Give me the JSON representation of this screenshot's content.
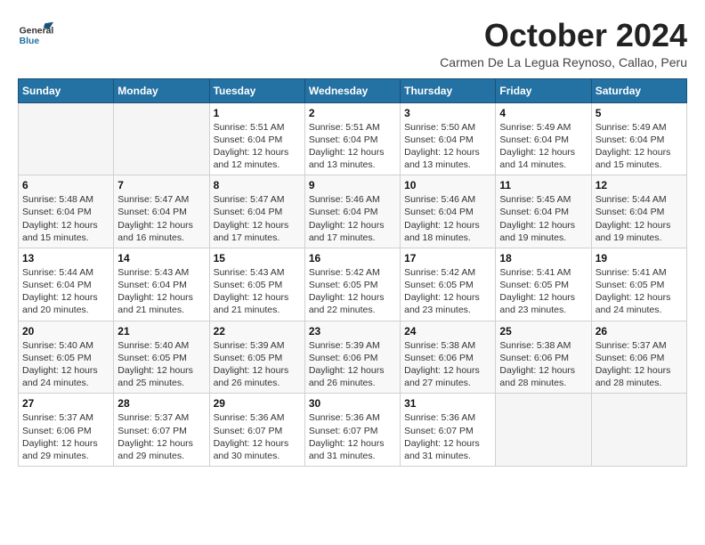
{
  "header": {
    "logo": {
      "line1": "General",
      "line2": "Blue"
    },
    "month": "October 2024",
    "location": "Carmen De La Legua Reynoso, Callao, Peru"
  },
  "weekdays": [
    "Sunday",
    "Monday",
    "Tuesday",
    "Wednesday",
    "Thursday",
    "Friday",
    "Saturday"
  ],
  "weeks": [
    [
      {
        "day": "",
        "info": ""
      },
      {
        "day": "",
        "info": ""
      },
      {
        "day": "1",
        "info": "Sunrise: 5:51 AM\nSunset: 6:04 PM\nDaylight: 12 hours\nand 12 minutes."
      },
      {
        "day": "2",
        "info": "Sunrise: 5:51 AM\nSunset: 6:04 PM\nDaylight: 12 hours\nand 13 minutes."
      },
      {
        "day": "3",
        "info": "Sunrise: 5:50 AM\nSunset: 6:04 PM\nDaylight: 12 hours\nand 13 minutes."
      },
      {
        "day": "4",
        "info": "Sunrise: 5:49 AM\nSunset: 6:04 PM\nDaylight: 12 hours\nand 14 minutes."
      },
      {
        "day": "5",
        "info": "Sunrise: 5:49 AM\nSunset: 6:04 PM\nDaylight: 12 hours\nand 15 minutes."
      }
    ],
    [
      {
        "day": "6",
        "info": "Sunrise: 5:48 AM\nSunset: 6:04 PM\nDaylight: 12 hours\nand 15 minutes."
      },
      {
        "day": "7",
        "info": "Sunrise: 5:47 AM\nSunset: 6:04 PM\nDaylight: 12 hours\nand 16 minutes."
      },
      {
        "day": "8",
        "info": "Sunrise: 5:47 AM\nSunset: 6:04 PM\nDaylight: 12 hours\nand 17 minutes."
      },
      {
        "day": "9",
        "info": "Sunrise: 5:46 AM\nSunset: 6:04 PM\nDaylight: 12 hours\nand 17 minutes."
      },
      {
        "day": "10",
        "info": "Sunrise: 5:46 AM\nSunset: 6:04 PM\nDaylight: 12 hours\nand 18 minutes."
      },
      {
        "day": "11",
        "info": "Sunrise: 5:45 AM\nSunset: 6:04 PM\nDaylight: 12 hours\nand 19 minutes."
      },
      {
        "day": "12",
        "info": "Sunrise: 5:44 AM\nSunset: 6:04 PM\nDaylight: 12 hours\nand 19 minutes."
      }
    ],
    [
      {
        "day": "13",
        "info": "Sunrise: 5:44 AM\nSunset: 6:04 PM\nDaylight: 12 hours\nand 20 minutes."
      },
      {
        "day": "14",
        "info": "Sunrise: 5:43 AM\nSunset: 6:04 PM\nDaylight: 12 hours\nand 21 minutes."
      },
      {
        "day": "15",
        "info": "Sunrise: 5:43 AM\nSunset: 6:05 PM\nDaylight: 12 hours\nand 21 minutes."
      },
      {
        "day": "16",
        "info": "Sunrise: 5:42 AM\nSunset: 6:05 PM\nDaylight: 12 hours\nand 22 minutes."
      },
      {
        "day": "17",
        "info": "Sunrise: 5:42 AM\nSunset: 6:05 PM\nDaylight: 12 hours\nand 23 minutes."
      },
      {
        "day": "18",
        "info": "Sunrise: 5:41 AM\nSunset: 6:05 PM\nDaylight: 12 hours\nand 23 minutes."
      },
      {
        "day": "19",
        "info": "Sunrise: 5:41 AM\nSunset: 6:05 PM\nDaylight: 12 hours\nand 24 minutes."
      }
    ],
    [
      {
        "day": "20",
        "info": "Sunrise: 5:40 AM\nSunset: 6:05 PM\nDaylight: 12 hours\nand 24 minutes."
      },
      {
        "day": "21",
        "info": "Sunrise: 5:40 AM\nSunset: 6:05 PM\nDaylight: 12 hours\nand 25 minutes."
      },
      {
        "day": "22",
        "info": "Sunrise: 5:39 AM\nSunset: 6:05 PM\nDaylight: 12 hours\nand 26 minutes."
      },
      {
        "day": "23",
        "info": "Sunrise: 5:39 AM\nSunset: 6:06 PM\nDaylight: 12 hours\nand 26 minutes."
      },
      {
        "day": "24",
        "info": "Sunrise: 5:38 AM\nSunset: 6:06 PM\nDaylight: 12 hours\nand 27 minutes."
      },
      {
        "day": "25",
        "info": "Sunrise: 5:38 AM\nSunset: 6:06 PM\nDaylight: 12 hours\nand 28 minutes."
      },
      {
        "day": "26",
        "info": "Sunrise: 5:37 AM\nSunset: 6:06 PM\nDaylight: 12 hours\nand 28 minutes."
      }
    ],
    [
      {
        "day": "27",
        "info": "Sunrise: 5:37 AM\nSunset: 6:06 PM\nDaylight: 12 hours\nand 29 minutes."
      },
      {
        "day": "28",
        "info": "Sunrise: 5:37 AM\nSunset: 6:07 PM\nDaylight: 12 hours\nand 29 minutes."
      },
      {
        "day": "29",
        "info": "Sunrise: 5:36 AM\nSunset: 6:07 PM\nDaylight: 12 hours\nand 30 minutes."
      },
      {
        "day": "30",
        "info": "Sunrise: 5:36 AM\nSunset: 6:07 PM\nDaylight: 12 hours\nand 31 minutes."
      },
      {
        "day": "31",
        "info": "Sunrise: 5:36 AM\nSunset: 6:07 PM\nDaylight: 12 hours\nand 31 minutes."
      },
      {
        "day": "",
        "info": ""
      },
      {
        "day": "",
        "info": ""
      }
    ]
  ]
}
